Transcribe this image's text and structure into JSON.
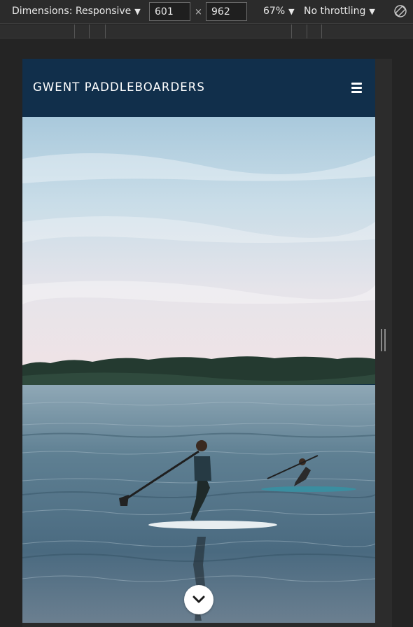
{
  "devtools": {
    "dimensions_label": "Dimensions: Responsive",
    "width_value": "601",
    "height_value": "962",
    "times_symbol": "×",
    "zoom_label": "67%",
    "throttle_label": "No throttling",
    "caret": "▼",
    "rotate_icon": "rotate-icon"
  },
  "site": {
    "brand": "GWENT PADDLEBOARDERS",
    "menu_icon": "hamburger-menu-icon",
    "scroll_icon": "chevron-down-icon"
  },
  "hero": {
    "description_icon": "photo of two people kneeling on paddleboards on a lake"
  }
}
